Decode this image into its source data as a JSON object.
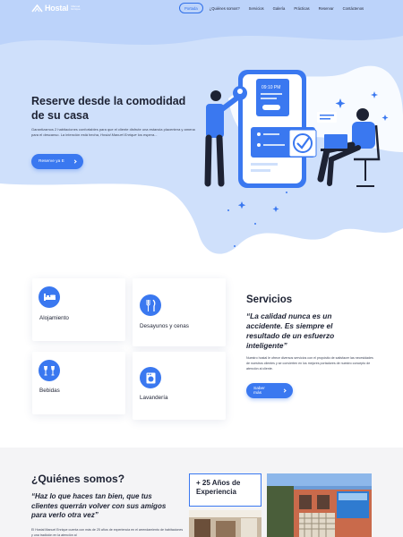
{
  "brand": {
    "name": "Hostal",
    "subtitle": "Manuel Enrique",
    "accent": "#3a78f0",
    "hero_bg": "#cfe0fb"
  },
  "nav": {
    "items": [
      {
        "label": "Portada",
        "active": true
      },
      {
        "label": "¿Quiénes somos?"
      },
      {
        "label": "Servicios"
      },
      {
        "label": "Galería"
      },
      {
        "label": "Prácticas"
      },
      {
        "label": "Reservar"
      },
      {
        "label": "Contáctenos"
      }
    ]
  },
  "hero": {
    "title": "Reserve desde la comodidad de su casa",
    "text_prefix": "Garantizamos 2 habitaciones confortables para que el cliente disfrute una estancia placentera y amena para el descanso. La intención está hecha, ",
    "text_italic": "Hostal Manuel Enrique",
    "text_suffix": " los espera...",
    "button_label": "Reserve ya E",
    "phone_time": "09:10 PM"
  },
  "services": {
    "cards": [
      {
        "label": "Alojamiento",
        "icon": "bed-icon"
      },
      {
        "label": "Desayunos y cenas",
        "icon": "utensils-icon"
      },
      {
        "label": "Bebidas",
        "icon": "glasses-icon"
      },
      {
        "label": "Lavandería",
        "icon": "washing-machine-icon"
      }
    ],
    "title": "Servicios",
    "quote": "“La calidad nunca es un accidente. Es siempre el resultado de un esfuerzo inteligente”",
    "text": "Nuestro hostal le ofrece diversos servicios con el propósito de satisfacer las necesidades de nuestros clientes y se convierten en los mejores portadores de nuestro concepto de atención al cliente.",
    "button_label": "Saber más"
  },
  "about": {
    "title": "¿Quiénes somos?",
    "quote": "“Haz lo que haces tan bien, que tus clientes querrán volver con sus amigos para verlo otra vez”",
    "text": "El Hostal Manuel Enrique cuenta con más de 25 años de experiencia en el arrendamiento de habitaciones y una tradición en la atención al",
    "experience": "+ 25 Años de Experiencia"
  }
}
